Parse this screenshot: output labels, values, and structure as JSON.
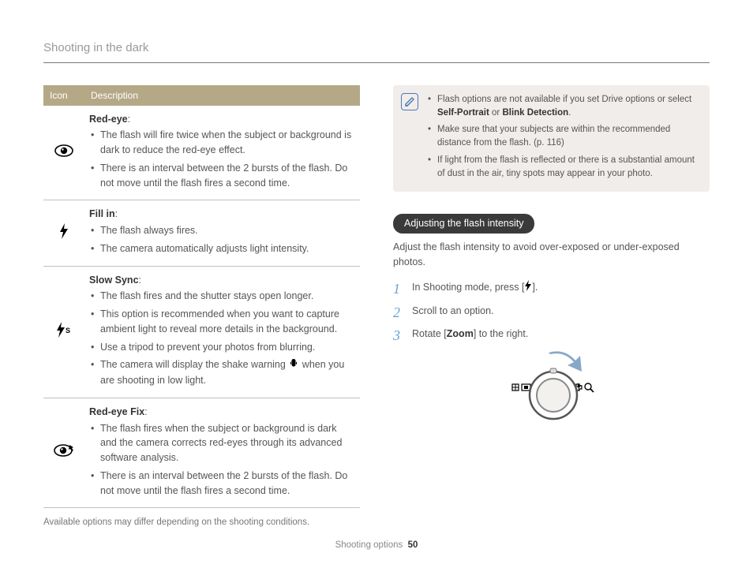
{
  "header": {
    "title": "Shooting in the dark"
  },
  "table": {
    "head": {
      "icon": "Icon",
      "desc": "Description"
    },
    "rows": [
      {
        "icon": "red-eye-icon",
        "title": "Red-eye",
        "bullets": [
          "The flash will fire twice when the subject or background is dark to reduce the red-eye effect.",
          "There is an interval between the 2 bursts of the flash. Do not move until the flash fires a second time."
        ]
      },
      {
        "icon": "fill-in-icon",
        "title": "Fill in",
        "bullets": [
          "The flash always fires.",
          "The camera automatically adjusts light intensity."
        ]
      },
      {
        "icon": "slow-sync-icon",
        "title": "Slow Sync",
        "bullets": [
          "The flash fires and the shutter stays open longer.",
          "This option is recommended when you want to capture ambient light to reveal more details in the background.",
          "Use a tripod to prevent your photos from blurring.",
          "The camera will display the shake warning   when you are shooting in low light."
        ],
        "inline_icon_bullet_index": 3,
        "inline_icon": "shake-warning-icon"
      },
      {
        "icon": "red-eye-fix-icon",
        "title": "Red-eye Fix",
        "bullets": [
          "The flash fires when the subject or background is dark and the camera corrects red-eyes through its advanced software analysis.",
          "There is an interval between the 2 bursts of the flash. Do not move until the flash fires a second time."
        ]
      }
    ],
    "footnote": "Available options may differ depending on the shooting conditions."
  },
  "notes": {
    "items": [
      {
        "pre": "Flash options are not available if you set Drive options or select ",
        "bold1": "Self-Portrait",
        "mid": " or ",
        "bold2": "Blink Detection",
        "post": "."
      },
      {
        "text": "Make sure that your subjects are within the recommended distance from the flash. (p. 116)"
      },
      {
        "text": "If light from the flash is reflected or there is a substantial amount of dust in the air, tiny spots may appear in your photo."
      }
    ]
  },
  "section": {
    "heading": "Adjusting the flash intensity",
    "intro": "Adjust the flash intensity to avoid over-exposed or under-exposed photos.",
    "steps": [
      {
        "pre": "In Shooting mode, press [",
        "icon": "flash-icon",
        "post": "]."
      },
      {
        "text": "Scroll to an option."
      },
      {
        "pre": "Rotate [",
        "bold": "Zoom",
        "post": "] to the right."
      }
    ]
  },
  "footer": {
    "section": "Shooting options",
    "page": "50"
  }
}
